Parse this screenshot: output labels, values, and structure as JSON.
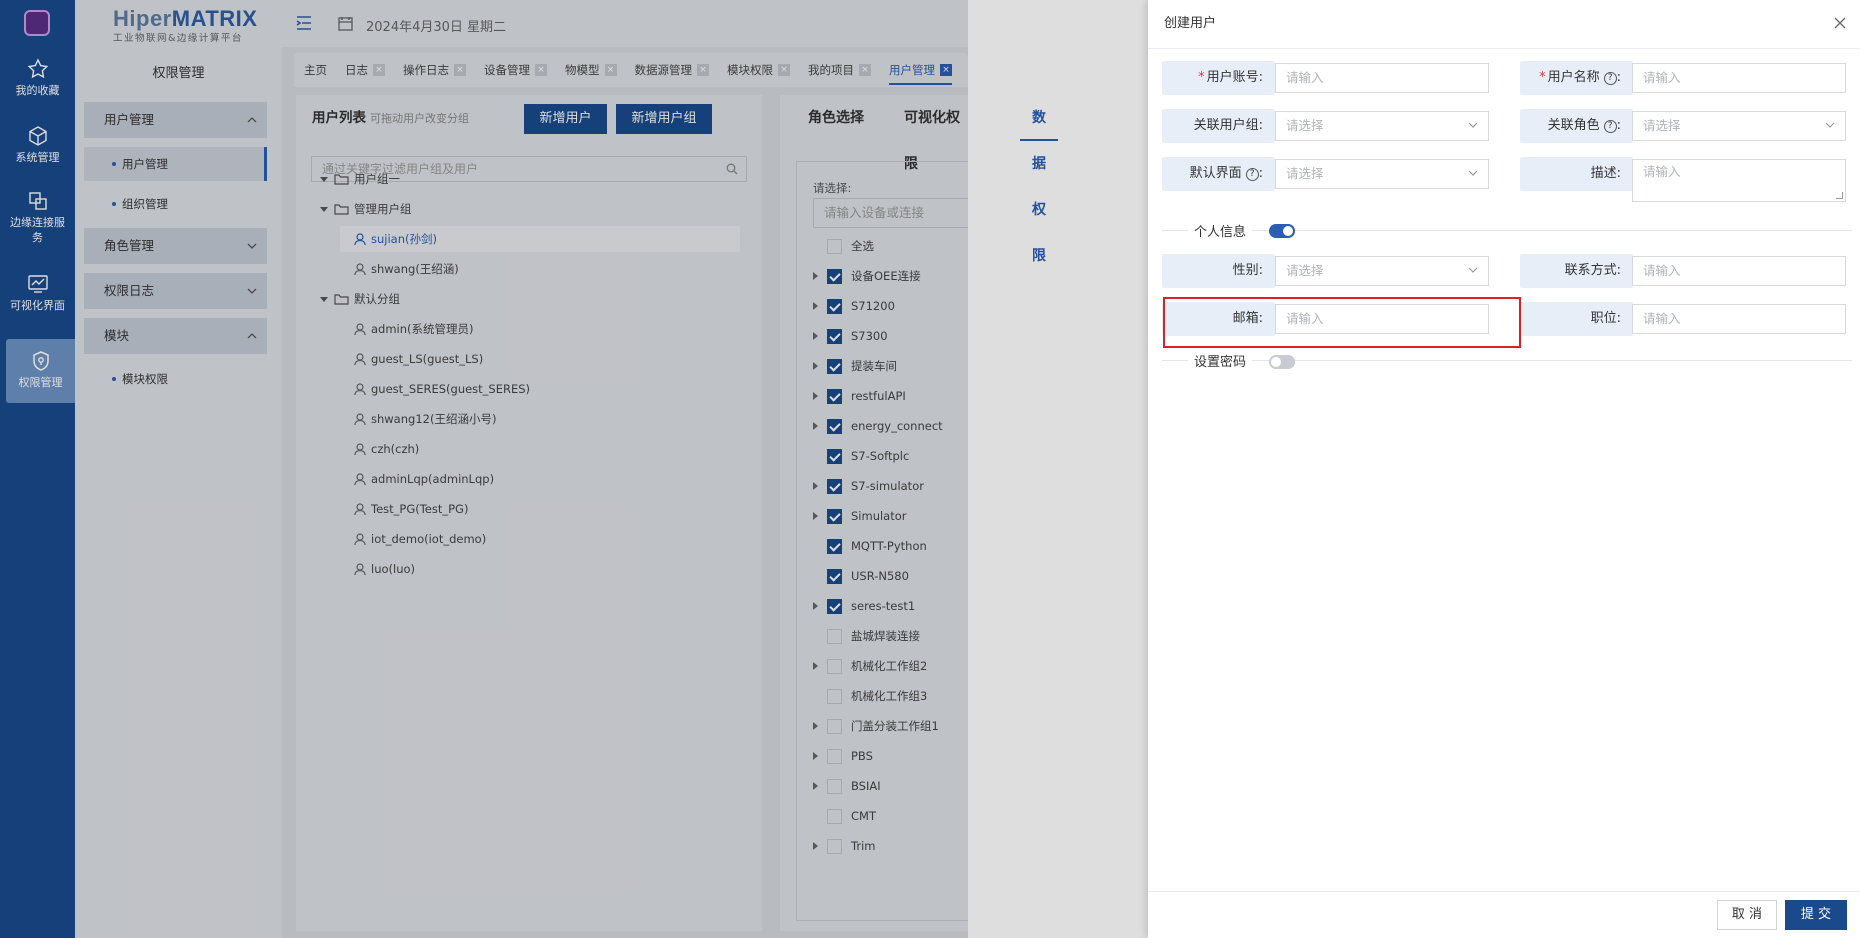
{
  "brand": {
    "name_a": "Hiper",
    "name_b": "MATRIX",
    "subtitle": "工业物联网&边缘计算平台"
  },
  "rail": {
    "items": [
      {
        "label": "我的收藏",
        "icon": "star-icon"
      },
      {
        "label": "系统管理",
        "icon": "cube-icon"
      },
      {
        "label": "边缘连接服务",
        "icon": "link-icon"
      },
      {
        "label": "可视化界面",
        "icon": "monitor-chart-icon"
      },
      {
        "label": "权限管理",
        "icon": "shield-icon"
      }
    ]
  },
  "sidenav": {
    "title": "权限管理",
    "groups": [
      {
        "label": "用户管理",
        "children": [
          {
            "label": "用户管理"
          },
          {
            "label": "组织管理"
          }
        ]
      },
      {
        "label": "角色管理"
      },
      {
        "label": "权限日志"
      },
      {
        "label": "模块",
        "children": [
          {
            "label": "模块权限"
          }
        ]
      }
    ]
  },
  "topbar": {
    "date": "2024年4月30日 星期二"
  },
  "tabs": [
    "主页",
    "日志",
    "操作日志",
    "设备管理",
    "物模型",
    "数据源管理",
    "模块权限",
    "我的项目",
    "用户管理"
  ],
  "userlist": {
    "title": "用户列表",
    "hint": "可拖动用户改变分组",
    "add_user": "新增用户",
    "add_group": "新增用户组",
    "search_placeholder": "通过关键字过滤用户组及用户",
    "groups": [
      "用户组一",
      "管理用户组",
      "默认分组"
    ],
    "admin_users": [
      "sujian(孙剑)",
      "shwang(王绍涵)"
    ],
    "default_users": [
      "admin(系统管理员)",
      "guest_LS(guest_LS)",
      "guest_SERES(guest_SERES)",
      "shwang12(王绍涵小号)",
      "czh(czh)",
      "adminLqp(adminLqp)",
      "Test_PG(Test_PG)",
      "iot_demo(iot_demo)",
      "luo(luo)"
    ]
  },
  "perm": {
    "tabs": [
      "角色选择",
      "可视化权限",
      "数据权限"
    ],
    "select_label": "请选择:",
    "search_placeholder": "请输入设备或连接",
    "select_all": "全选",
    "items": [
      {
        "label": "设备OEE连接",
        "checked": true,
        "expandable": true
      },
      {
        "label": "S71200",
        "checked": true,
        "expandable": true
      },
      {
        "label": "S7300",
        "checked": true,
        "expandable": true
      },
      {
        "label": "提装车间",
        "checked": true,
        "expandable": true
      },
      {
        "label": "restfulAPI",
        "checked": true,
        "expandable": true
      },
      {
        "label": "energy_connect",
        "checked": true,
        "expandable": true
      },
      {
        "label": "S7-Softplc",
        "checked": true,
        "expandable": false
      },
      {
        "label": "S7-simulator",
        "checked": true,
        "expandable": true
      },
      {
        "label": "Simulator",
        "checked": true,
        "expandable": true
      },
      {
        "label": "MQTT-Python",
        "checked": true,
        "expandable": false
      },
      {
        "label": "USR-N580",
        "checked": true,
        "expandable": false
      },
      {
        "label": "seres-test1",
        "checked": true,
        "expandable": true
      },
      {
        "label": "盐城焊装连接",
        "checked": false,
        "expandable": false
      },
      {
        "label": "机械化工作组2",
        "checked": false,
        "expandable": true
      },
      {
        "label": "机械化工作组3",
        "checked": false,
        "expandable": false
      },
      {
        "label": "门盖分装工作组1",
        "checked": false,
        "expandable": true
      },
      {
        "label": "PBS",
        "checked": false,
        "expandable": true
      },
      {
        "label": "BSIAI",
        "checked": false,
        "expandable": true
      },
      {
        "label": "CMT",
        "checked": false,
        "expandable": false
      },
      {
        "label": "Trim",
        "checked": false,
        "expandable": true
      }
    ]
  },
  "drawer": {
    "title": "创建用户",
    "fields": {
      "account": {
        "label": "用户账号:",
        "placeholder": "请输入"
      },
      "username": {
        "label": "用户名称",
        "placeholder": "请输入"
      },
      "group": {
        "label": "关联用户组:",
        "placeholder": "请选择"
      },
      "role": {
        "label": "关联角色",
        "placeholder": "请选择"
      },
      "default_view": {
        "label": "默认界面",
        "placeholder": "请选择"
      },
      "desc": {
        "label": "描述:",
        "placeholder": "请输入"
      },
      "gender": {
        "label": "性别:",
        "placeholder": "请选择"
      },
      "contact": {
        "label": "联系方式:",
        "placeholder": "请输入"
      },
      "email": {
        "label": "邮箱:",
        "placeholder": "请输入"
      },
      "position": {
        "label": "职位:",
        "placeholder": "请输入"
      }
    },
    "personal_section": "个人信息",
    "personal_enabled": true,
    "password_section": "设置密码",
    "password_enabled": false,
    "cancel": "取 消",
    "submit": "提 交"
  },
  "colors": {
    "primary": "#1a4a8c",
    "accent": "#2a5db3",
    "highlight_box": "#e02020",
    "required": "#e0353a"
  }
}
